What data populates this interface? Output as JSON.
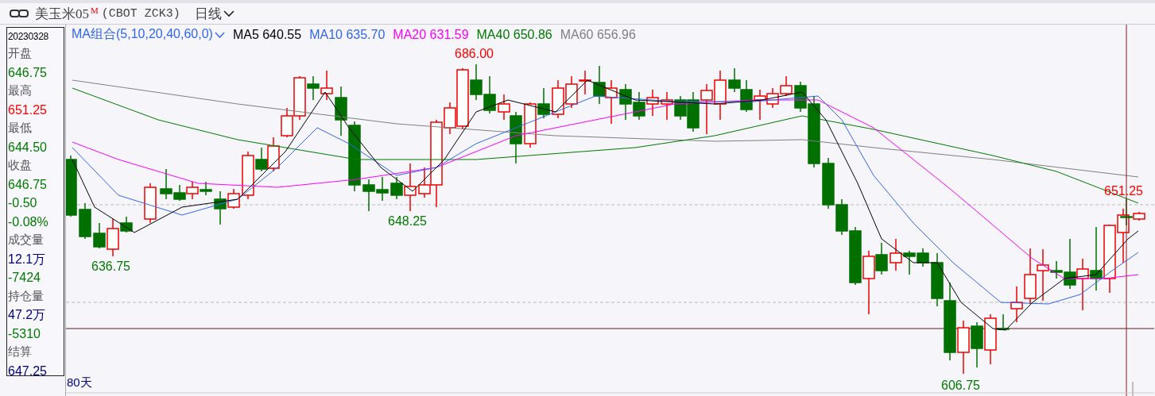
{
  "header": {
    "symbol": "美玉米05",
    "badge": "M",
    "code": "(CBOT ZCK3)",
    "period": "日线"
  },
  "legend": {
    "title": "MA组合(5,10,20,40,60,0)",
    "items": [
      {
        "label": "MA5 640.55",
        "color": "#000000"
      },
      {
        "label": "MA10 635.70",
        "color": "#3366ee"
      },
      {
        "label": "MA20 631.59",
        "color": "#ff00ff"
      },
      {
        "label": "MA40 650.86",
        "color": "#007a00"
      },
      {
        "label": "MA60 656.96",
        "color": "#808080"
      }
    ]
  },
  "quote_panel": {
    "date": "20230328",
    "rows": [
      {
        "kind": "label",
        "text": "开盘"
      },
      {
        "kind": "value",
        "text": "646.75",
        "color": "#007a00"
      },
      {
        "kind": "label",
        "text": "最高"
      },
      {
        "kind": "value",
        "text": "651.25",
        "color": "#ff0000"
      },
      {
        "kind": "label",
        "text": "最低"
      },
      {
        "kind": "value",
        "text": "644.50",
        "color": "#007a00"
      },
      {
        "kind": "label",
        "text": "收盘"
      },
      {
        "kind": "value",
        "text": "646.75",
        "color": "#007a00"
      },
      {
        "kind": "value",
        "text": "-0.50",
        "color": "#007a00"
      },
      {
        "kind": "value",
        "text": "-0.08%",
        "color": "#007a00"
      },
      {
        "kind": "label",
        "text": "成交量"
      },
      {
        "kind": "value",
        "text": "12.1万",
        "color": "#000080"
      },
      {
        "kind": "value",
        "text": "-7424",
        "color": "#007a00"
      },
      {
        "kind": "label",
        "text": "持仓量"
      },
      {
        "kind": "value",
        "text": "47.2万",
        "color": "#000080"
      },
      {
        "kind": "value",
        "text": "-5310",
        "color": "#007a00"
      },
      {
        "kind": "label",
        "text": "结算"
      },
      {
        "kind": "value",
        "text": "647.25",
        "color": "#000080"
      }
    ]
  },
  "chart": {
    "price_labels": [
      {
        "text": "686.00",
        "kind": "high"
      },
      {
        "text": "648.25",
        "kind": "low"
      },
      {
        "text": "636.75",
        "kind": "low"
      },
      {
        "text": "606.75",
        "kind": "low"
      },
      {
        "text": "651.25",
        "kind": "high"
      }
    ],
    "footer": "80天"
  }
}
